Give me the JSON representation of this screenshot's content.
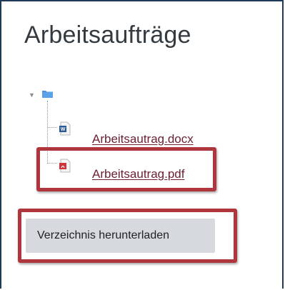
{
  "heading": "Arbeitsaufträge",
  "tree": {
    "folder_icon": "folder-icon",
    "files": [
      {
        "name": "Arbeitsautrag.docx",
        "icon": "word-document-icon",
        "color": "#2b5797"
      },
      {
        "name": "Arbeitsautrag.pdf",
        "icon": "pdf-document-icon",
        "color": "#d13438"
      }
    ]
  },
  "download_button": "Verzeichnis herunterladen",
  "colors": {
    "link": "#6b2232",
    "highlight": "#b0363d",
    "button_bg": "#d6d9de"
  }
}
